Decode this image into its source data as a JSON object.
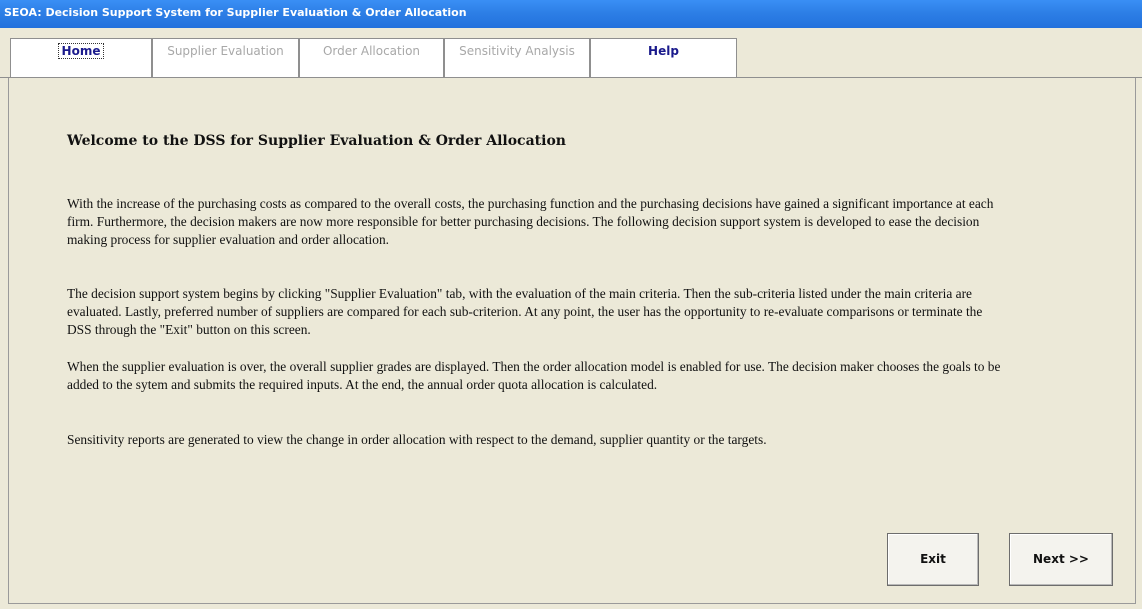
{
  "window": {
    "title": "SEOA: Decision Support System for Supplier Evaluation & Order Allocation"
  },
  "tabs": [
    {
      "label": "Home",
      "state": "active"
    },
    {
      "label": "Supplier Evaluation",
      "state": "disabled"
    },
    {
      "label": "Order Allocation",
      "state": "disabled"
    },
    {
      "label": "Sensitivity Analysis",
      "state": "disabled"
    },
    {
      "label": "Help",
      "state": "enabled"
    }
  ],
  "home": {
    "heading": "Welcome to the DSS for Supplier Evaluation & Order Allocation",
    "paragraphs": [
      "With the increase of the purchasing costs as compared to the overall costs, the purchasing function and the purchasing decisions have gained a significant importance at each firm. Furthermore, the decision makers are now more responsible for better purchasing decisions. The following decision support system is developed to ease the decision making process for supplier evaluation and order allocation.",
      "The decision support system begins by clicking \"Supplier Evaluation\" tab, with the evaluation of the main criteria. Then the sub-criteria listed under the main criteria are evaluated. Lastly, preferred number of suppliers are compared for each sub-criterion. At any point, the user has the opportunity to re-evaluate comparisons or terminate the DSS through the \"Exit\" button on this screen.",
      "When the supplier evaluation is over, the overall supplier grades are displayed. Then the order allocation model is enabled for use. The decision maker chooses the goals to be added to the sytem and submits the required inputs. At the end, the annual order quota allocation is calculated.",
      "Sensitivity reports are generated to view the change in order allocation with respect to the demand, supplier quantity or the targets."
    ],
    "buttons": {
      "exit": "Exit",
      "next": "Next >>"
    }
  },
  "colors": {
    "titlebar": "#2d7fe6",
    "window_bg": "#ece9d8",
    "help_text": "#1a1a8c",
    "disabled_text": "#a8a8a8"
  }
}
